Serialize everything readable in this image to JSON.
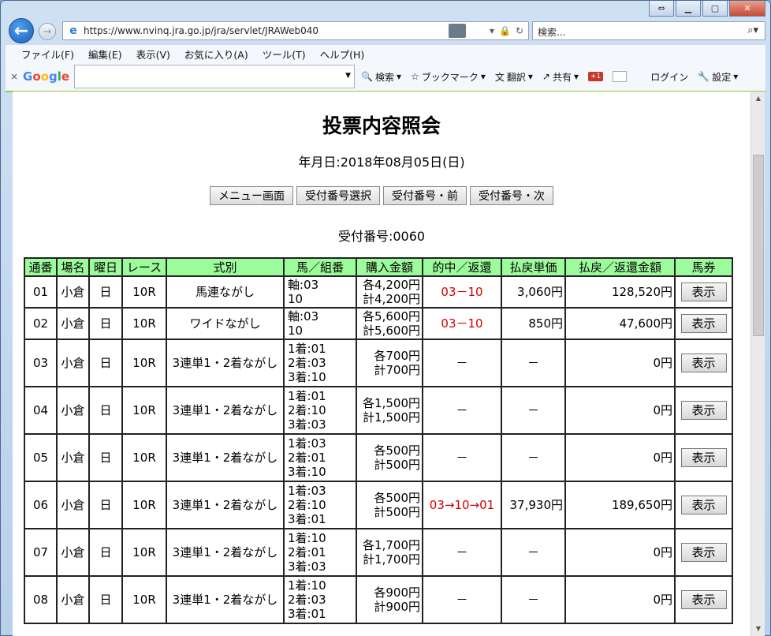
{
  "browser": {
    "url": "https://www.nvinq.jra.go.jp/jra/servlet/JRAWeb040",
    "search_placeholder": "検索...",
    "menu": [
      "ファイル(F)",
      "編集(E)",
      "表示(V)",
      "お気に入り(A)",
      "ツール(T)",
      "ヘルプ(H)"
    ],
    "google": {
      "search_label": "検索",
      "bookmark_label": "ブックマーク",
      "translate_label": "翻訳",
      "share_label": "共有",
      "gplus_label": "+1",
      "login_label": "ログイン",
      "settings_label": "設定"
    }
  },
  "page": {
    "title": "投票内容照会",
    "date_line": "年月日:2018年08月05日(日)",
    "buttons": [
      "メニュー画面",
      "受付番号選択",
      "受付番号・前",
      "受付番号・次"
    ],
    "receipt": "受付番号:0060",
    "headers": [
      "通番",
      "場名",
      "曜日",
      "レース",
      "式別",
      "馬／組番",
      "購入金額",
      "的中／返還",
      "払戻単価",
      "払戻／返還金額",
      "馬券"
    ],
    "view_label": "表示",
    "rows": [
      {
        "no": "01",
        "place": "小倉",
        "day": "日",
        "race": "10R",
        "type": "馬連ながし",
        "horses": [
          "軸:03",
          "10"
        ],
        "amount": [
          "各4,200円",
          "計4,200円"
        ],
        "hit": "03－10",
        "hit_red": true,
        "unit": "3,060円",
        "total": "128,520円"
      },
      {
        "no": "02",
        "place": "小倉",
        "day": "日",
        "race": "10R",
        "type": "ワイドながし",
        "horses": [
          "軸:03",
          "10"
        ],
        "amount": [
          "各5,600円",
          "計5,600円"
        ],
        "hit": "03－10",
        "hit_red": true,
        "unit": "850円",
        "total": "47,600円"
      },
      {
        "no": "03",
        "place": "小倉",
        "day": "日",
        "race": "10R",
        "type": "3連単1・2着ながし",
        "horses": [
          "1着:01",
          "2着:03",
          "3着:10"
        ],
        "amount": [
          "各700円",
          "計700円"
        ],
        "hit": "－",
        "hit_red": false,
        "unit": "－",
        "total": "0円"
      },
      {
        "no": "04",
        "place": "小倉",
        "day": "日",
        "race": "10R",
        "type": "3連単1・2着ながし",
        "horses": [
          "1着:01",
          "2着:10",
          "3着:03"
        ],
        "amount": [
          "各1,500円",
          "計1,500円"
        ],
        "hit": "－",
        "hit_red": false,
        "unit": "－",
        "total": "0円"
      },
      {
        "no": "05",
        "place": "小倉",
        "day": "日",
        "race": "10R",
        "type": "3連単1・2着ながし",
        "horses": [
          "1着:03",
          "2着:01",
          "3着:10"
        ],
        "amount": [
          "各500円",
          "計500円"
        ],
        "hit": "－",
        "hit_red": false,
        "unit": "－",
        "total": "0円"
      },
      {
        "no": "06",
        "place": "小倉",
        "day": "日",
        "race": "10R",
        "type": "3連単1・2着ながし",
        "horses": [
          "1着:03",
          "2着:10",
          "3着:01"
        ],
        "amount": [
          "各500円",
          "計500円"
        ],
        "hit": "03→10→01",
        "hit_red": true,
        "unit": "37,930円",
        "total": "189,650円"
      },
      {
        "no": "07",
        "place": "小倉",
        "day": "日",
        "race": "10R",
        "type": "3連単1・2着ながし",
        "horses": [
          "1着:10",
          "2着:01",
          "3着:03"
        ],
        "amount": [
          "各1,700円",
          "計1,700円"
        ],
        "hit": "－",
        "hit_red": false,
        "unit": "－",
        "total": "0円"
      },
      {
        "no": "08",
        "place": "小倉",
        "day": "日",
        "race": "10R",
        "type": "3連単1・2着ながし",
        "horses": [
          "1着:10",
          "2着:03",
          "3着:01"
        ],
        "amount": [
          "各900円",
          "計900円"
        ],
        "hit": "－",
        "hit_red": false,
        "unit": "－",
        "total": "0円"
      }
    ]
  }
}
